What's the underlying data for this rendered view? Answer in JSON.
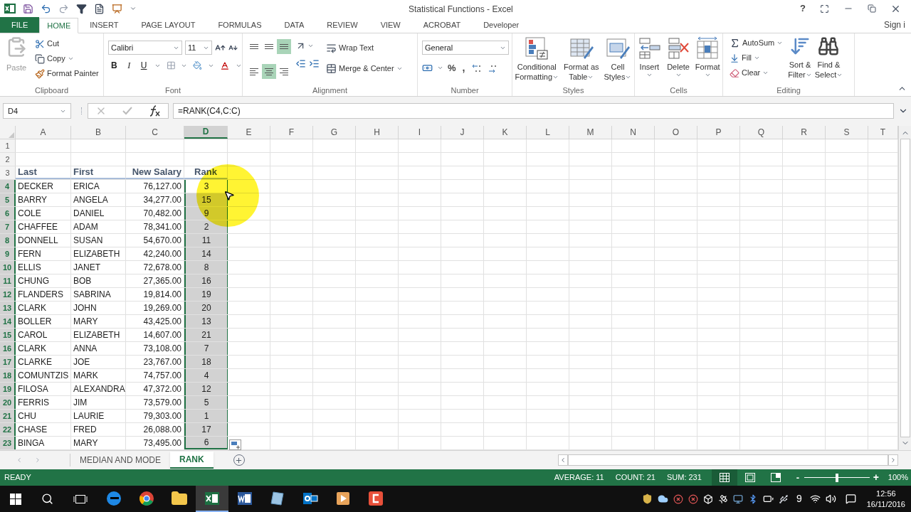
{
  "window": {
    "title": "Statistical Functions - Excel",
    "help": "?"
  },
  "ribbon_tabs": [
    {
      "label": "FILE",
      "kind": "file",
      "selected": false
    },
    {
      "label": "HOME",
      "kind": "tab",
      "selected": true
    },
    {
      "label": "INSERT",
      "kind": "tab",
      "selected": false
    },
    {
      "label": "PAGE LAYOUT",
      "kind": "tab",
      "selected": false
    },
    {
      "label": "FORMULAS",
      "kind": "tab",
      "selected": false
    },
    {
      "label": "DATA",
      "kind": "tab",
      "selected": false
    },
    {
      "label": "REVIEW",
      "kind": "tab",
      "selected": false
    },
    {
      "label": "VIEW",
      "kind": "tab",
      "selected": false
    },
    {
      "label": "ACROBAT",
      "kind": "tab",
      "selected": false
    },
    {
      "label": "Developer",
      "kind": "tab",
      "selected": false
    }
  ],
  "sign_in": "Sign i",
  "clipboard": {
    "label": "Clipboard",
    "paste": {
      "label": "Paste",
      "disabled": true
    },
    "cut": "Cut",
    "copy": "Copy",
    "format_painter": "Format Painter"
  },
  "font": {
    "label": "Font",
    "name": "Calibri",
    "size": "11",
    "bold": "B",
    "italic": "I",
    "underline": "U"
  },
  "alignment": {
    "label": "Alignment",
    "wrap_text": "Wrap Text",
    "merge_center": "Merge & Center",
    "buttons": [
      {
        "kind": "top",
        "selected": false
      },
      {
        "kind": "middle",
        "selected": false
      },
      {
        "kind": "bottom",
        "selected": true
      },
      {
        "kind": "left",
        "selected": false
      },
      {
        "kind": "center",
        "selected": true
      },
      {
        "kind": "right",
        "selected": false
      }
    ]
  },
  "number": {
    "label": "Number",
    "format": "General",
    "percent": "%",
    "comma": ","
  },
  "styles": {
    "label": "Styles",
    "buttons": [
      {
        "kind": "conditional",
        "lines": [
          "Conditional",
          "Formatting"
        ]
      },
      {
        "kind": "table",
        "lines": [
          "Format as",
          "Table"
        ]
      },
      {
        "kind": "cellstyles",
        "lines": [
          "Cell",
          "Styles"
        ]
      }
    ]
  },
  "cells": {
    "label": "Cells",
    "buttons": [
      {
        "kind": "insert",
        "label": "Insert"
      },
      {
        "kind": "delete",
        "label": "Delete"
      },
      {
        "kind": "format",
        "label": "Format"
      }
    ]
  },
  "editing": {
    "label": "Editing",
    "autosum": "AutoSum",
    "fill": "Fill",
    "clear": "Clear",
    "sort": [
      "Sort &",
      "Filter"
    ],
    "find": [
      "Find &",
      "Select"
    ]
  },
  "formula_bar": {
    "name_box": "D4",
    "formula": "=RANK(C4,C:C)"
  },
  "columns": [
    {
      "label": "A",
      "selected": false
    },
    {
      "label": "B",
      "selected": false
    },
    {
      "label": "C",
      "selected": false
    },
    {
      "label": "D",
      "selected": true
    },
    {
      "label": "E",
      "selected": false
    },
    {
      "label": "F",
      "selected": false
    },
    {
      "label": "G",
      "selected": false
    },
    {
      "label": "H",
      "selected": false
    },
    {
      "label": "I",
      "selected": false
    },
    {
      "label": "J",
      "selected": false
    },
    {
      "label": "K",
      "selected": false
    },
    {
      "label": "L",
      "selected": false
    },
    {
      "label": "M",
      "selected": false
    },
    {
      "label": "N",
      "selected": false
    },
    {
      "label": "O",
      "selected": false
    },
    {
      "label": "P",
      "selected": false
    },
    {
      "label": "Q",
      "selected": false
    },
    {
      "label": "R",
      "selected": false
    },
    {
      "label": "S",
      "selected": false
    },
    {
      "label": "T",
      "selected": false
    }
  ],
  "rows": [
    {
      "num": "1",
      "kind": "empty"
    },
    {
      "num": "2",
      "kind": "empty"
    },
    {
      "num": "3",
      "kind": "header",
      "cells": [
        "Last",
        "First",
        "New Salary",
        "Rank"
      ]
    },
    {
      "num": "4",
      "kind": "data",
      "selected": true,
      "active": true,
      "cells": [
        "DECKER",
        "ERICA",
        "76,127.00",
        "3"
      ]
    },
    {
      "num": "5",
      "kind": "data",
      "selected": true,
      "active": false,
      "cells": [
        "BARRY",
        "ANGELA",
        "34,277.00",
        "15"
      ]
    },
    {
      "num": "6",
      "kind": "data",
      "selected": true,
      "active": false,
      "cells": [
        "COLE",
        "DANIEL",
        "70,482.00",
        "9"
      ]
    },
    {
      "num": "7",
      "kind": "data",
      "selected": true,
      "active": false,
      "cells": [
        "CHAFFEE",
        "ADAM",
        "78,341.00",
        "2"
      ]
    },
    {
      "num": "8",
      "kind": "data",
      "selected": true,
      "active": false,
      "cells": [
        "DONNELL",
        "SUSAN",
        "54,670.00",
        "11"
      ]
    },
    {
      "num": "9",
      "kind": "data",
      "selected": true,
      "active": false,
      "cells": [
        "FERN",
        "ELIZABETH",
        "42,240.00",
        "14"
      ]
    },
    {
      "num": "10",
      "kind": "data",
      "selected": true,
      "active": false,
      "cells": [
        "ELLIS",
        "JANET",
        "72,678.00",
        "8"
      ]
    },
    {
      "num": "11",
      "kind": "data",
      "selected": true,
      "active": false,
      "cells": [
        "CHUNG",
        "BOB",
        "27,365.00",
        "16"
      ]
    },
    {
      "num": "12",
      "kind": "data",
      "selected": true,
      "active": false,
      "cells": [
        "FLANDERS",
        "SABRINA",
        "19,814.00",
        "19"
      ]
    },
    {
      "num": "13",
      "kind": "data",
      "selected": true,
      "active": false,
      "cells": [
        "CLARK",
        "JOHN",
        "19,269.00",
        "20"
      ]
    },
    {
      "num": "14",
      "kind": "data",
      "selected": true,
      "active": false,
      "cells": [
        "BOLLER",
        "MARY",
        "43,425.00",
        "13"
      ]
    },
    {
      "num": "15",
      "kind": "data",
      "selected": true,
      "active": false,
      "cells": [
        "CAROL",
        "ELIZABETH",
        "14,607.00",
        "21"
      ]
    },
    {
      "num": "16",
      "kind": "data",
      "selected": true,
      "active": false,
      "cells": [
        "CLARK",
        "ANNA",
        "73,108.00",
        "7"
      ]
    },
    {
      "num": "17",
      "kind": "data",
      "selected": true,
      "active": false,
      "cells": [
        "CLARKE",
        "JOE",
        "23,767.00",
        "18"
      ]
    },
    {
      "num": "18",
      "kind": "data",
      "selected": true,
      "active": false,
      "cells": [
        "COMUNTZIS",
        "MARK",
        "74,757.00",
        "4"
      ]
    },
    {
      "num": "19",
      "kind": "data",
      "selected": true,
      "active": false,
      "cells": [
        "FILOSA",
        "ALEXANDRA",
        "47,372.00",
        "12"
      ]
    },
    {
      "num": "20",
      "kind": "data",
      "selected": true,
      "active": false,
      "cells": [
        "FERRIS",
        "JIM",
        "73,579.00",
        "5"
      ]
    },
    {
      "num": "21",
      "kind": "data",
      "selected": true,
      "active": false,
      "cells": [
        "CHU",
        "LAURIE",
        "79,303.00",
        "1"
      ]
    },
    {
      "num": "22",
      "kind": "data",
      "selected": true,
      "active": false,
      "cells": [
        "CHASE",
        "FRED",
        "26,088.00",
        "17"
      ]
    },
    {
      "num": "23",
      "kind": "data",
      "selected": true,
      "active": false,
      "cells": [
        "BINGA",
        "MARY",
        "73,495.00",
        "6"
      ]
    }
  ],
  "sheet_tabs": [
    {
      "label": "MEDIAN AND MODE",
      "selected": false
    },
    {
      "label": "RANK",
      "selected": true
    }
  ],
  "status_bar": {
    "ready": "READY",
    "stats": [
      "AVERAGE: 11",
      "COUNT: 21",
      "SUM: 231"
    ],
    "views": [
      {
        "kind": "normal",
        "selected": true
      },
      {
        "kind": "layout",
        "selected": false
      },
      {
        "kind": "pagebreak",
        "selected": false
      }
    ],
    "zoom_out": "-",
    "zoom_in": "+",
    "zoom": {
      "level": 0.5
    },
    "zoom_reading": "100%"
  },
  "taskbar": {
    "apps": [
      {
        "kind": "browser",
        "selected": false
      },
      {
        "kind": "chrome",
        "selected": false
      },
      {
        "kind": "folder",
        "selected": false
      },
      {
        "kind": "excel",
        "selected": true
      },
      {
        "kind": "word",
        "selected": false
      },
      {
        "kind": "notepad",
        "selected": false
      },
      {
        "kind": "mail",
        "selected": false
      },
      {
        "kind": "player",
        "selected": false
      },
      {
        "kind": "recorder",
        "selected": false
      }
    ],
    "tray_count": "9",
    "time": "12:56",
    "date": "16/11/2016"
  }
}
